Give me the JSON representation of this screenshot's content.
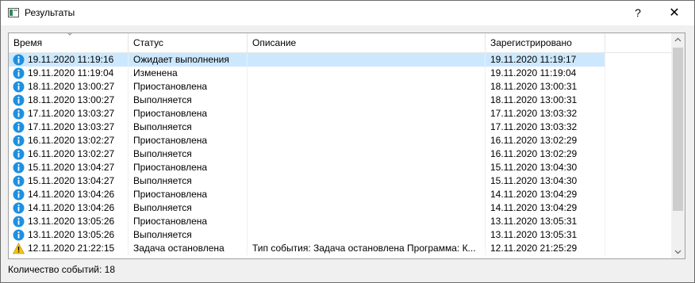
{
  "window": {
    "title": "Результаты",
    "help_label": "?",
    "close_label": "✕"
  },
  "table": {
    "columns": [
      "Время",
      "Статус",
      "Описание",
      "Зарегистрировано"
    ],
    "rows": [
      {
        "icon": "info-icon",
        "time": "19.11.2020 11:19:16",
        "status": "Ожидает выполнения",
        "description": "",
        "registered": "19.11.2020 11:19:17",
        "selected": true
      },
      {
        "icon": "info-icon",
        "time": "19.11.2020 11:19:04",
        "status": "Изменена",
        "description": "",
        "registered": "19.11.2020 11:19:04"
      },
      {
        "icon": "info-icon",
        "time": "18.11.2020 13:00:27",
        "status": "Приостановлена",
        "description": "",
        "registered": "18.11.2020 13:00:31"
      },
      {
        "icon": "info-icon",
        "time": "18.11.2020 13:00:27",
        "status": "Выполняется",
        "description": "",
        "registered": "18.11.2020 13:00:31"
      },
      {
        "icon": "info-icon",
        "time": "17.11.2020 13:03:27",
        "status": "Приостановлена",
        "description": "",
        "registered": "17.11.2020 13:03:32"
      },
      {
        "icon": "info-icon",
        "time": "17.11.2020 13:03:27",
        "status": "Выполняется",
        "description": "",
        "registered": "17.11.2020 13:03:32"
      },
      {
        "icon": "info-icon",
        "time": "16.11.2020 13:02:27",
        "status": "Приостановлена",
        "description": "",
        "registered": "16.11.2020 13:02:29"
      },
      {
        "icon": "info-icon",
        "time": "16.11.2020 13:02:27",
        "status": "Выполняется",
        "description": "",
        "registered": "16.11.2020 13:02:29"
      },
      {
        "icon": "info-icon",
        "time": "15.11.2020 13:04:27",
        "status": "Приостановлена",
        "description": "",
        "registered": "15.11.2020 13:04:30"
      },
      {
        "icon": "info-icon",
        "time": "15.11.2020 13:04:27",
        "status": "Выполняется",
        "description": "",
        "registered": "15.11.2020 13:04:30"
      },
      {
        "icon": "info-icon",
        "time": "14.11.2020 13:04:26",
        "status": "Приостановлена",
        "description": "",
        "registered": "14.11.2020 13:04:29"
      },
      {
        "icon": "info-icon",
        "time": "14.11.2020 13:04:26",
        "status": "Выполняется",
        "description": "",
        "registered": "14.11.2020 13:04:29"
      },
      {
        "icon": "info-icon",
        "time": "13.11.2020 13:05:26",
        "status": "Приостановлена",
        "description": "",
        "registered": "13.11.2020 13:05:31"
      },
      {
        "icon": "info-icon",
        "time": "13.11.2020 13:05:26",
        "status": "Выполняется",
        "description": "",
        "registered": "13.11.2020 13:05:31"
      },
      {
        "icon": "warning-icon",
        "time": "12.11.2020 21:22:15",
        "status": "Задача остановлена",
        "description": "Тип события:     Задача остановлена  Программа:     К...",
        "registered": "12.11.2020 21:25:29"
      }
    ]
  },
  "status_bar": {
    "text": "Количество событий: 18"
  },
  "colors": {
    "selection": "#cce8ff",
    "info_icon": "#1e90e0",
    "warning_icon": "#f0c419"
  }
}
